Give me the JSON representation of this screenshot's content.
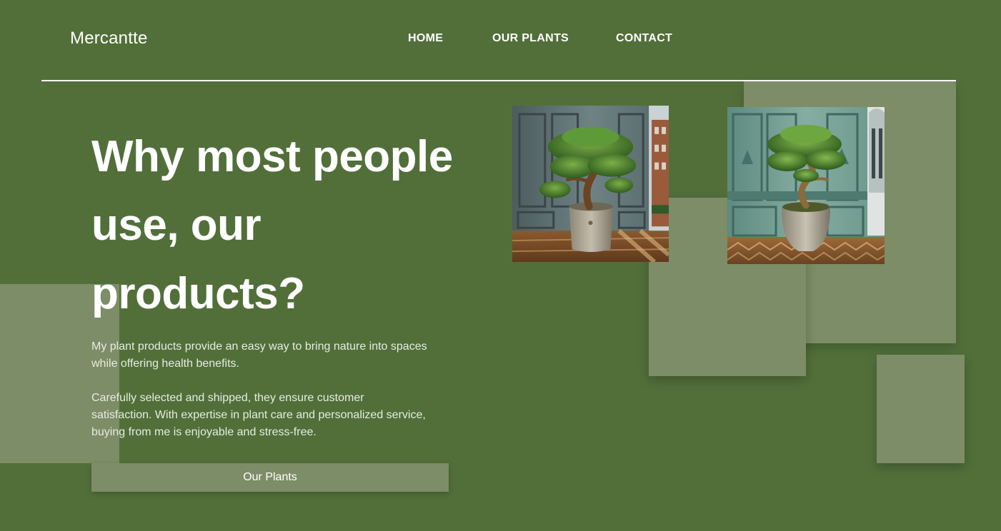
{
  "header": {
    "brand": "Mercantte",
    "nav": [
      {
        "label": "HOME"
      },
      {
        "label": "OUR PLANTS"
      },
      {
        "label": "CONTACT"
      }
    ]
  },
  "hero": {
    "title": "Why most people use, our products?",
    "paragraph_1": "My plant products provide an easy way to bring nature into spaces while offering health benefits.",
    "paragraph_2": "Carefully selected and shipped, they ensure customer satisfaction. With expertise in plant care and personalized service, buying from me is enjoyable and stress-free.",
    "cta_label": "Our Plants"
  },
  "colors": {
    "background": "#526f3a",
    "accent_block": "#7c8d67",
    "text": "#ffffff"
  },
  "products": [
    {
      "image": "bonsai-in-grey-panelled-room"
    },
    {
      "image": "bonsai-in-green-panelled-room"
    }
  ]
}
